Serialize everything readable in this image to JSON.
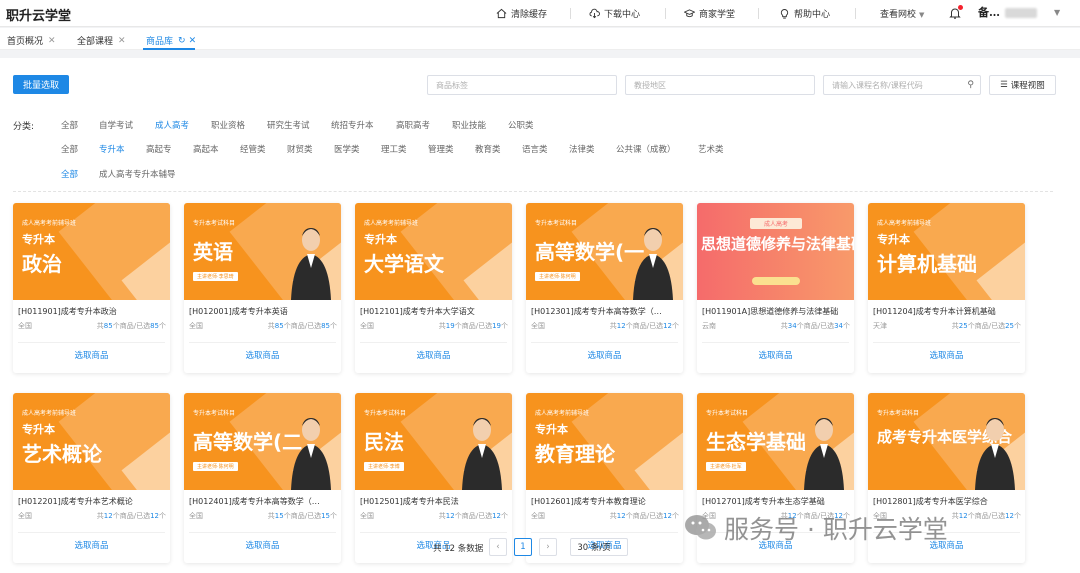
{
  "app": {
    "brand": "职升云学堂"
  },
  "topbar": {
    "tools": [
      {
        "label": "清除缓存",
        "icon": "home-icon"
      },
      {
        "label": "下载中心",
        "icon": "cloud-download-icon"
      },
      {
        "label": "商家学堂",
        "icon": "graduation-cap-icon"
      },
      {
        "label": "帮助中心",
        "icon": "lightbulb-icon"
      }
    ],
    "campus": "查看网校",
    "user_initials": "备…"
  },
  "tabs": [
    {
      "label": "首页概况"
    },
    {
      "label": "全部课程"
    },
    {
      "label": "商品库"
    }
  ],
  "toolbar": {
    "batch_select": "批量选取",
    "tag_placeholder": "商品标签",
    "region_placeholder": "教授地区",
    "search_placeholder": "请输入课程名称/课程代码",
    "tree_button": "课程视图"
  },
  "filters": {
    "label": "分类:",
    "row1": [
      "全部",
      "自学考试",
      "成人高考",
      "职业资格",
      "研究生考试",
      "统招专升本",
      "高职高考",
      "职业技能",
      "公职类"
    ],
    "row2": [
      "全部",
      "专升本",
      "高起专",
      "高起本",
      "经管类",
      "财贸类",
      "医学类",
      "理工类",
      "管理类",
      "教育类",
      "语言类",
      "法律类",
      "公共课（成教）",
      "艺术类"
    ],
    "row3": [
      "全部",
      "成人高考专升本辅导"
    ]
  },
  "cards": [
    {
      "top": "成人高考考前辅导班",
      "sub": "专升本",
      "big": "政治",
      "teacher": "",
      "title": "[H011901]成考专升本政治",
      "region": "全国",
      "total": "85",
      "picked": "85"
    },
    {
      "top": "专升本考试科目",
      "sub": "",
      "big": "英语",
      "teacher": "主讲老师·李思琦",
      "title": "[H012001]成考专升本英语",
      "region": "全国",
      "total": "85",
      "picked": "85"
    },
    {
      "top": "成人高考考前辅导班",
      "sub": "专升本",
      "big": "大学语文",
      "teacher": "",
      "title": "[H012101]成考专升本大学语文",
      "region": "全国",
      "total": "19",
      "picked": "19"
    },
    {
      "top": "专升本考试科目",
      "sub": "",
      "big": "高等数学(一",
      "teacher": "主讲老师·陈何明",
      "title": "[H012301]成考专升本高等数学（…",
      "region": "全国",
      "total": "12",
      "picked": "12"
    },
    {
      "top": "成人高考",
      "sub": "",
      "big": "思想道德修养与法律基础",
      "teacher": "",
      "title": "[H011901A]思想道德修养与法律基础",
      "region": "云南",
      "total": "34",
      "picked": "34"
    },
    {
      "top": "成人高考考前辅导班",
      "sub": "专升本",
      "big": "计算机基础",
      "teacher": "",
      "title": "[H011204]成考专升本计算机基础",
      "region": "天津",
      "total": "25",
      "picked": "25"
    },
    {
      "top": "成人高考考前辅导班",
      "sub": "专升本",
      "big": "艺术概论",
      "teacher": "",
      "title": "[H012201]成考专升本艺术概论",
      "region": "全国",
      "total": "12",
      "picked": "12"
    },
    {
      "top": "专升本考试科目",
      "sub": "",
      "big": "高等数学(二",
      "teacher": "主讲老师·陈何明",
      "title": "[H012401]成考专升本高等数学（…",
      "region": "全国",
      "total": "15",
      "picked": "15"
    },
    {
      "top": "专升本考试科目",
      "sub": "",
      "big": "民法",
      "teacher": "主讲老师·李博",
      "title": "[H012501]成考专升本民法",
      "region": "全国",
      "total": "12",
      "picked": "12"
    },
    {
      "top": "成人高考考前辅导班",
      "sub": "专升本",
      "big": "教育理论",
      "teacher": "",
      "title": "[H012601]成考专升本教育理论",
      "region": "全国",
      "total": "12",
      "picked": "12"
    },
    {
      "top": "专升本考试科目",
      "sub": "",
      "big": "生态学基础",
      "teacher": "主讲老师·杜军",
      "title": "[H012701]成考专升本生态学基础",
      "region": "全国",
      "total": "12",
      "picked": "12"
    },
    {
      "top": "专升本考试科目",
      "sub": "",
      "big": "成考专升本医学综合",
      "teacher": "",
      "title": "[H012801]成考专升本医学综合",
      "region": "全国",
      "total": "12",
      "picked": "12"
    }
  ],
  "card_action": "选取商品",
  "count_text": {
    "prefix": "共",
    "mid": "个商品/已选",
    "suffix": "个"
  },
  "pagination": {
    "total": "共 12 条数据",
    "page": "1",
    "page_size": "30 条/页"
  },
  "watermark": "服务号 · 职升云学堂"
}
